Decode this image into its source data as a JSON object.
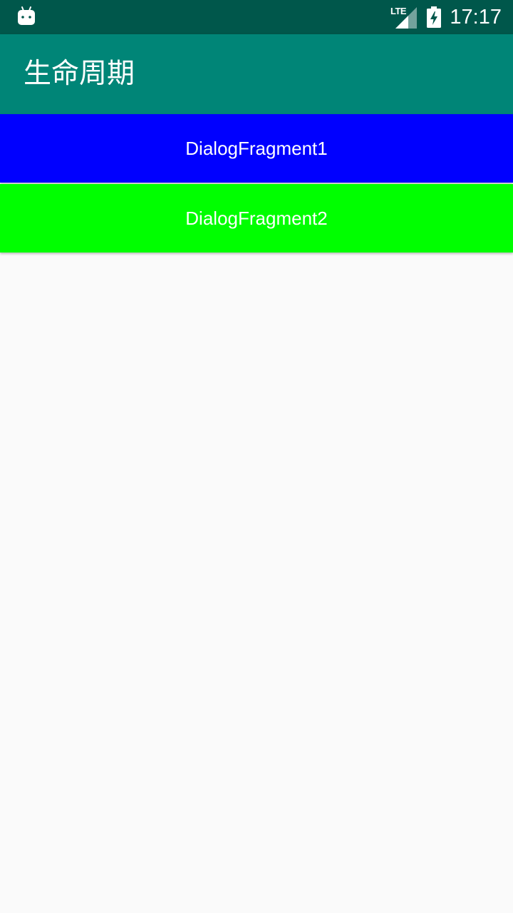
{
  "status_bar": {
    "network_label": "LTE",
    "time": "17:17",
    "icons": [
      "android-debug-icon",
      "signal-icon",
      "battery-charging-icon"
    ]
  },
  "app_bar": {
    "title": "生命周期"
  },
  "buttons": [
    {
      "label": "DialogFragment1",
      "color": "#0000ff"
    },
    {
      "label": "DialogFragment2",
      "color": "#00ff00"
    }
  ],
  "colors": {
    "status_bar": "#00574b",
    "app_bar": "#008577",
    "background": "#fafafa"
  }
}
